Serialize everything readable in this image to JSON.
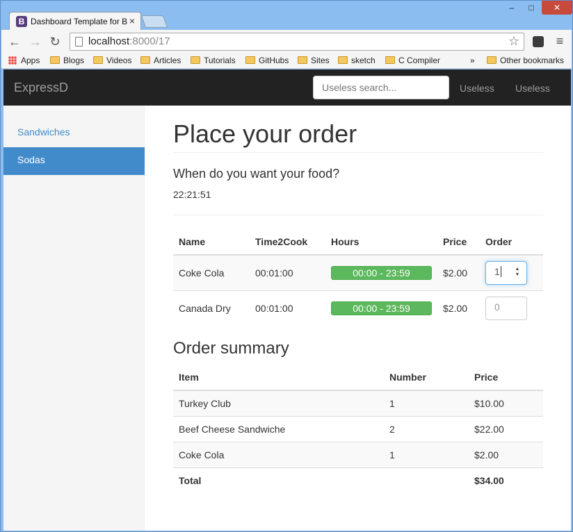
{
  "browser": {
    "tab_title": "Dashboard Template for B",
    "tab_icon_letter": "B",
    "url_host": "localhost",
    "url_path": ":8000/17",
    "bookmarks": [
      "Apps",
      "Blogs",
      "Videos",
      "Articles",
      "Tutorials",
      "GitHubs",
      "Sites",
      "sketch",
      "C Compiler"
    ],
    "more_bookmarks": "»",
    "other_bookmarks": "Other bookmarks"
  },
  "navbar": {
    "brand": "ExpressD",
    "search_placeholder": "Useless search...",
    "links": [
      "Useless",
      "Useless"
    ]
  },
  "sidebar": {
    "items": [
      {
        "label": "Sandwiches",
        "active": false
      },
      {
        "label": "Sodas",
        "active": true
      }
    ]
  },
  "main": {
    "title": "Place your order",
    "question": "When do you want your food?",
    "time": "22:21:51",
    "order_table": {
      "headers": [
        "Name",
        "Time2Cook",
        "Hours",
        "Price",
        "Order"
      ],
      "rows": [
        {
          "name": "Coke Cola",
          "time2cook": "00:01:00",
          "hours": "00:00 - 23:59",
          "price": "$2.00",
          "order_value": "1",
          "order_placeholder": ""
        },
        {
          "name": "Canada Dry",
          "time2cook": "00:01:00",
          "hours": "00:00 - 23:59",
          "price": "$2.00",
          "order_value": "",
          "order_placeholder": "0"
        }
      ]
    },
    "summary_title": "Order summary",
    "summary_table": {
      "headers": [
        "Item",
        "Number",
        "Price"
      ],
      "rows": [
        {
          "item": "Turkey Club",
          "number": "1",
          "price": "$10.00"
        },
        {
          "item": "Beef Cheese Sandwiche",
          "number": "2",
          "price": "$22.00"
        },
        {
          "item": "Coke Cola",
          "number": "1",
          "price": "$2.00"
        }
      ],
      "total_label": "Total",
      "total_price": "$34.00"
    }
  },
  "colors": {
    "accent": "#428bca",
    "navbar_bg": "#222222",
    "success": "#5cb85c"
  }
}
